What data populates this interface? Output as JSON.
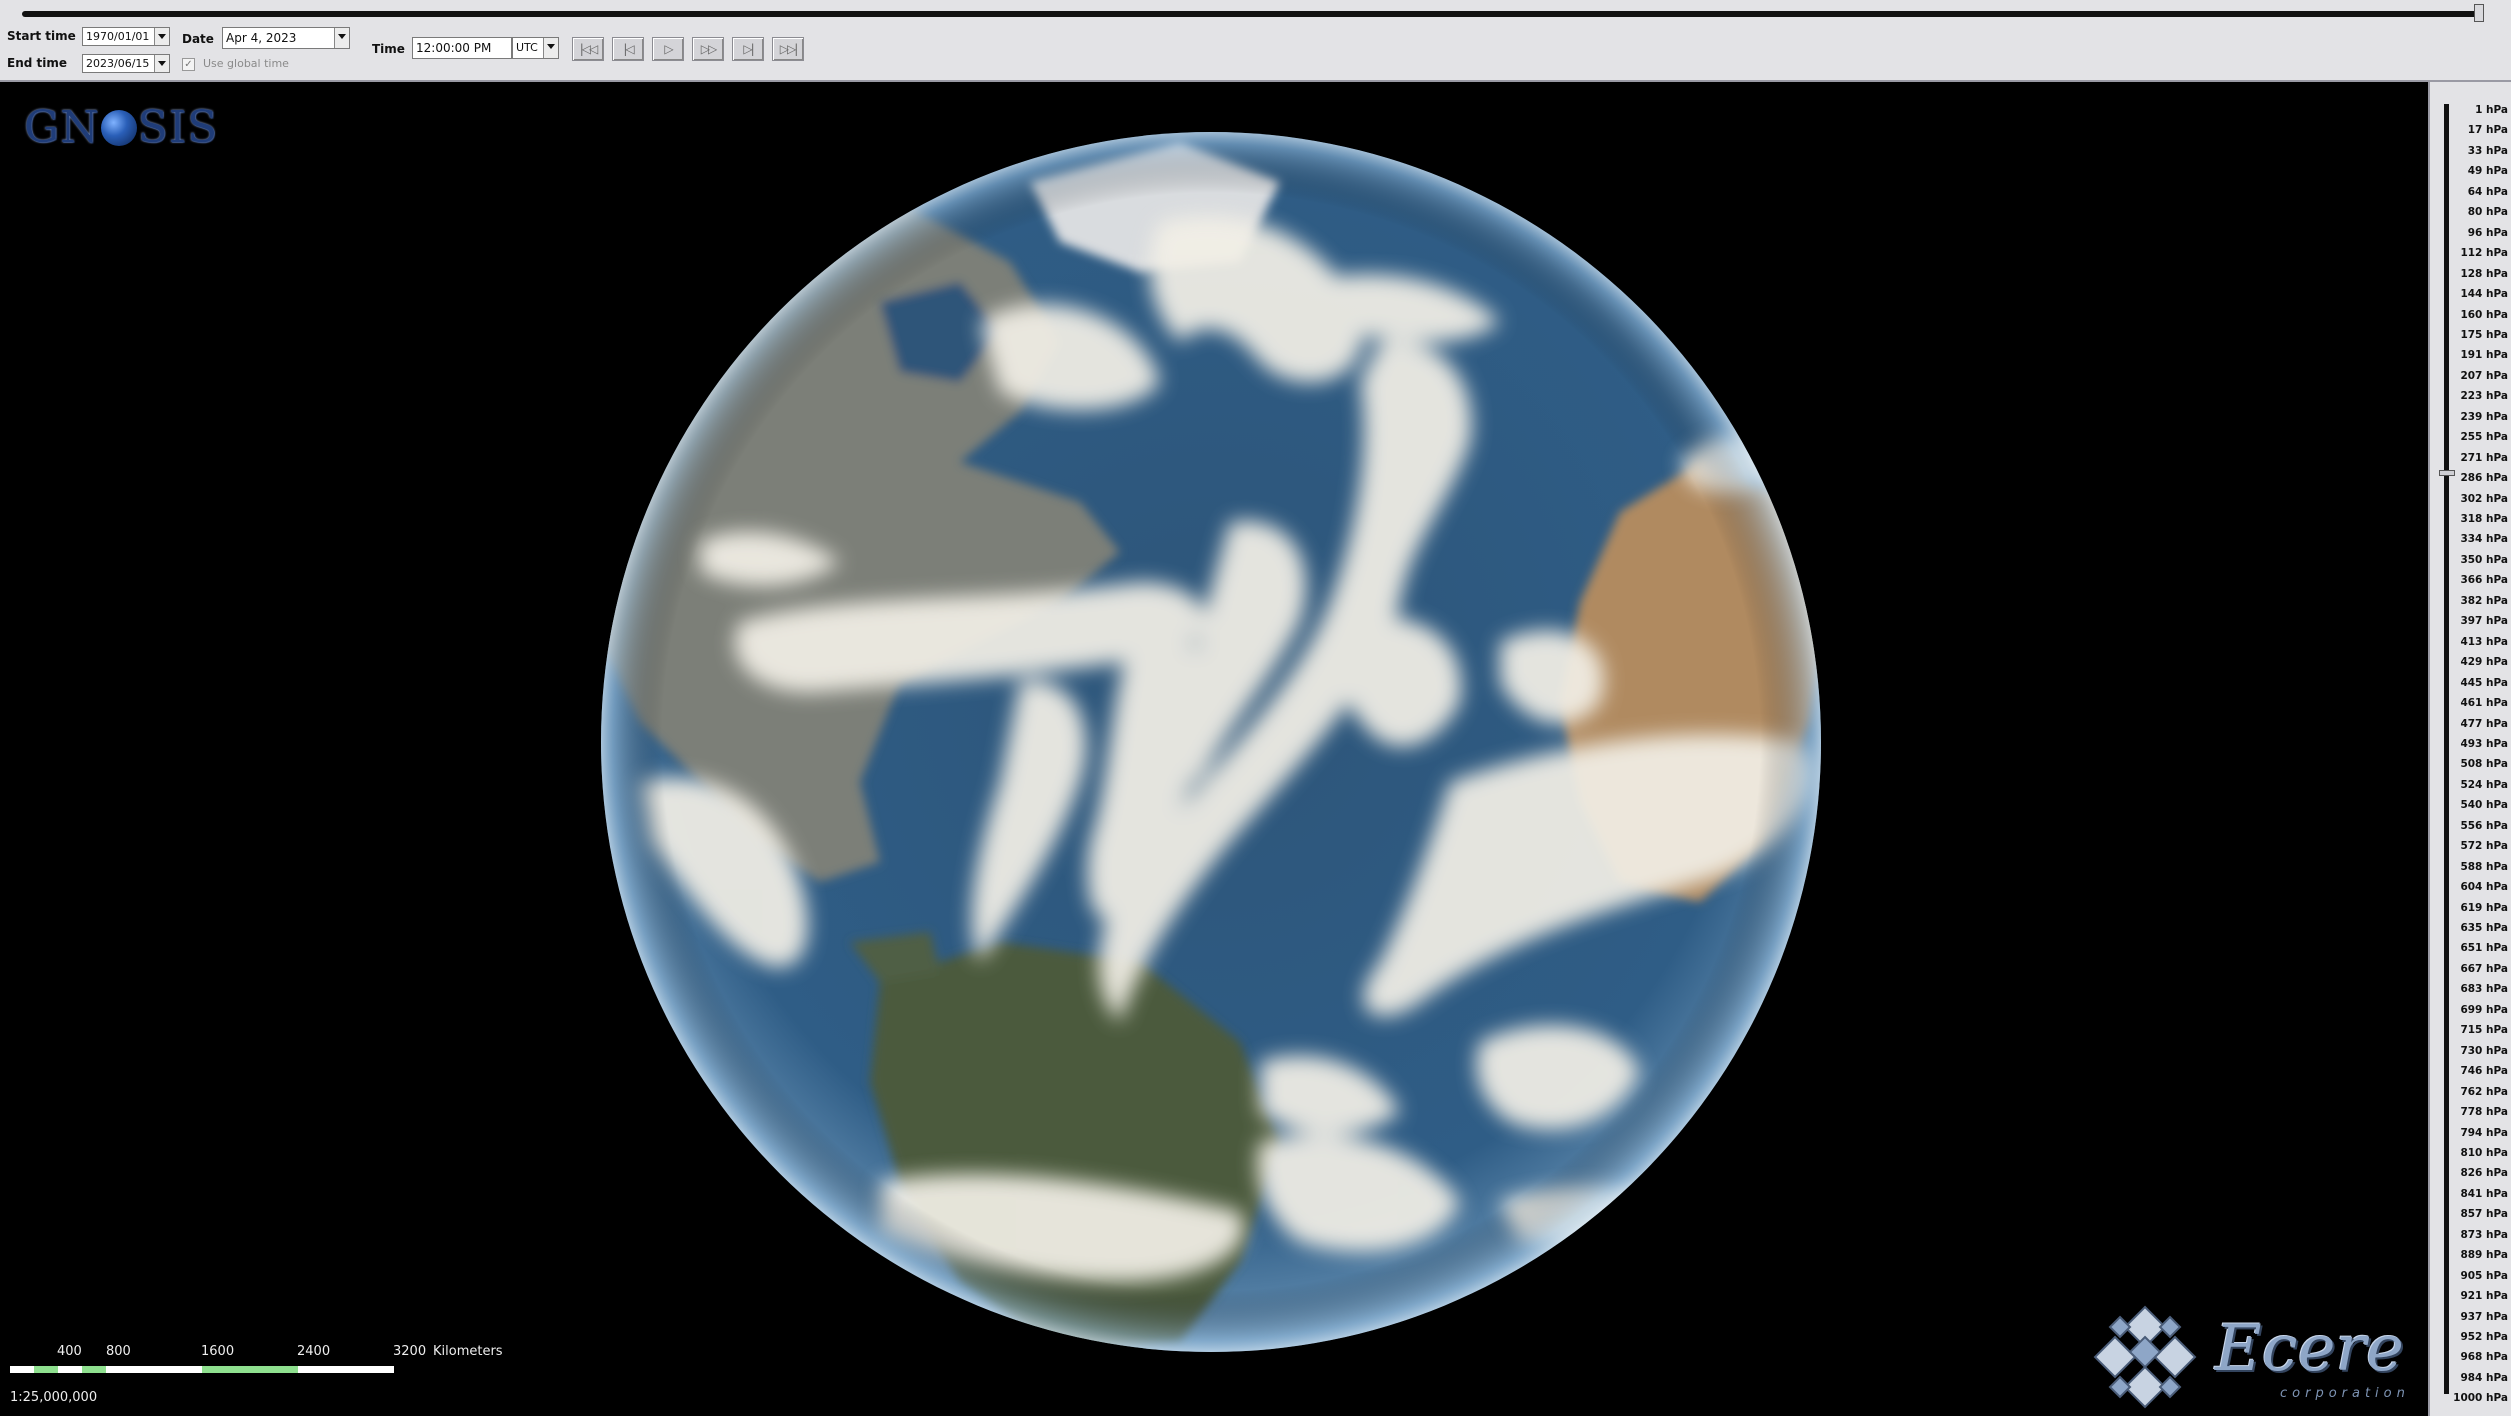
{
  "toolbar": {
    "start_time_label": "Start time",
    "start_time_value": "1970/01/01",
    "end_time_label": "End time",
    "end_time_value": "2023/06/15",
    "date_label": "Date",
    "date_value": "Apr 4, 2023",
    "use_global_time_label": "Use global time",
    "time_label": "Time",
    "time_value": "12:00:00 PM",
    "timezone_value": "UTC",
    "nav_buttons": [
      "first",
      "previous",
      "play",
      "next",
      "last",
      "fast-forward"
    ]
  },
  "viewport": {
    "logo_text_1": "GN",
    "logo_text_2": "SIS",
    "scale": {
      "ticks": [
        "400",
        "800",
        "1600",
        "2400",
        "3200"
      ],
      "unit": "Kilometers",
      "ratio": "1:25,000,000"
    },
    "brand_word": "Ecere",
    "brand_sub": "corporation"
  },
  "pressure_levels": [
    "1 hPa",
    "17 hPa",
    "33 hPa",
    "49 hPa",
    "64 hPa",
    "80 hPa",
    "96 hPa",
    "112 hPa",
    "128 hPa",
    "144 hPa",
    "160 hPa",
    "175 hPa",
    "191 hPa",
    "207 hPa",
    "223 hPa",
    "239 hPa",
    "255 hPa",
    "271 hPa",
    "286 hPa",
    "302 hPa",
    "318 hPa",
    "334 hPa",
    "350 hPa",
    "366 hPa",
    "382 hPa",
    "397 hPa",
    "413 hPa",
    "429 hPa",
    "445 hPa",
    "461 hPa",
    "477 hPa",
    "493 hPa",
    "508 hPa",
    "524 hPa",
    "540 hPa",
    "556 hPa",
    "572 hPa",
    "588 hPa",
    "604 hPa",
    "619 hPa",
    "635 hPa",
    "651 hPa",
    "667 hPa",
    "683 hPa",
    "699 hPa",
    "715 hPa",
    "730 hPa",
    "746 hPa",
    "762 hPa",
    "778 hPa",
    "794 hPa",
    "810 hPa",
    "826 hPa",
    "841 hPa",
    "857 hPa",
    "873 hPa",
    "889 hPa",
    "905 hPa",
    "921 hPa",
    "937 hPa",
    "952 hPa",
    "968 hPa",
    "984 hPa",
    "1000 hPa"
  ],
  "colors": {
    "ocean": "#2d5579",
    "cloud": "#f2efe6",
    "land_north": "#7c7f78",
    "land_africa": "#b08a60",
    "land_south": "#4c5a3e"
  }
}
